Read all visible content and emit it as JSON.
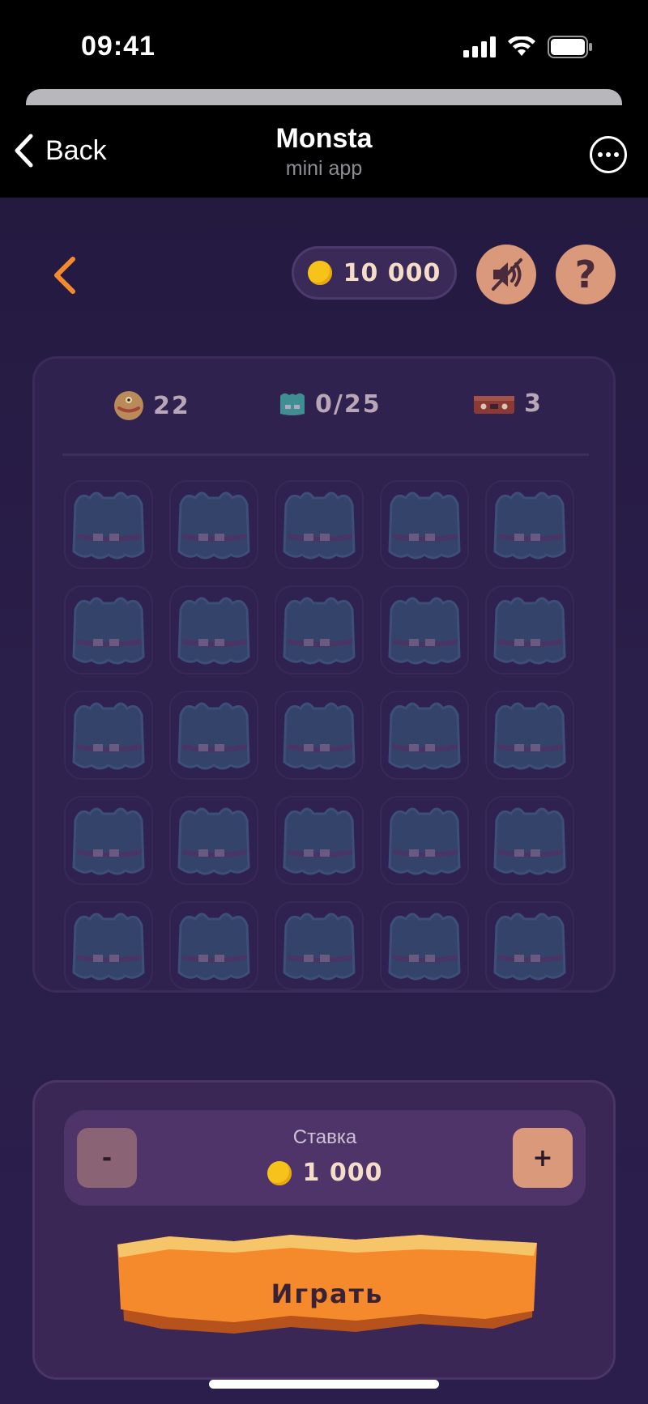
{
  "status_bar": {
    "time": "09:41"
  },
  "nav": {
    "back_label": "Back",
    "title": "Monsta",
    "subtitle": "mini app"
  },
  "header": {
    "balance": "10 000",
    "help_symbol": "?"
  },
  "stats": {
    "coins": "22",
    "monsters": "0/25",
    "chests": "3"
  },
  "grid": {
    "rows": 5,
    "cols": 5,
    "tile_icon": "furry-monster-icon"
  },
  "bet": {
    "label": "Ставка",
    "amount": "1 000",
    "minus": "-",
    "plus": "+"
  },
  "play": {
    "label": "Играть"
  },
  "colors": {
    "accent": "#f58a2c",
    "coin": "#f7c21a",
    "button": "#d9997a",
    "panel": "#30224f"
  }
}
